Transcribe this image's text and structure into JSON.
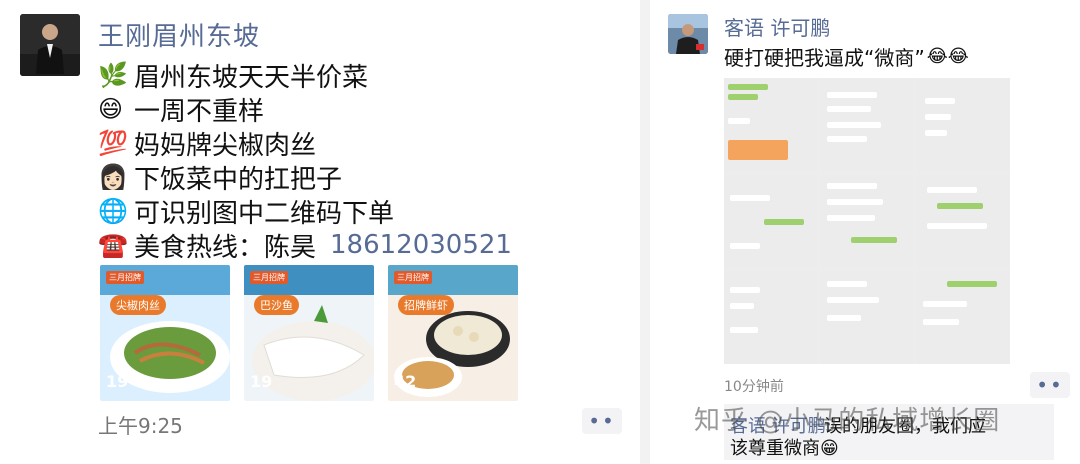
{
  "left_post": {
    "author": "王刚眉州东坡",
    "lines": [
      {
        "emoji": "🌿",
        "text": "眉州东坡天天半价菜"
      },
      {
        "emoji": "😄",
        "text": "一周不重样"
      },
      {
        "emoji": "💯",
        "text": "妈妈牌尖椒肉丝"
      },
      {
        "emoji": "👩🏻",
        "text": "下饭菜中的扛把子"
      },
      {
        "emoji": "🌐",
        "text": "可识别图中二维码下单"
      },
      {
        "emoji": "☎️",
        "text": "美食热线：陈昊",
        "phone": "18612030521"
      }
    ],
    "thumbnails": [
      {
        "tag": "三月招牌",
        "label": "尖椒肉丝",
        "price": "19",
        "colors": [
          "#5aa9d8",
          "#dcefff"
        ]
      },
      {
        "tag": "三月招牌",
        "label": "巴沙鱼",
        "price": "19",
        "colors": [
          "#3f8fc0",
          "#eef4f8"
        ]
      },
      {
        "tag": "三月招牌",
        "label": "招牌鲜虾",
        "price": "42",
        "colors": [
          "#58a6c9",
          "#f7efe5"
        ]
      }
    ],
    "time": "上午9:25",
    "more": "••"
  },
  "right_post": {
    "author": "客语 许可鹏",
    "caption": "硬打硬把我逼成“微商”",
    "caption_emoji": "😂😂",
    "time": "10分钟前",
    "more": "••",
    "comment": {
      "who": "客语 许可鹏:",
      "text_line1": "误的朋友圈，我们应",
      "text_line2": "该尊重微商",
      "emoji": "😁"
    },
    "watermark": "知乎 @小马的私域增长圈"
  }
}
